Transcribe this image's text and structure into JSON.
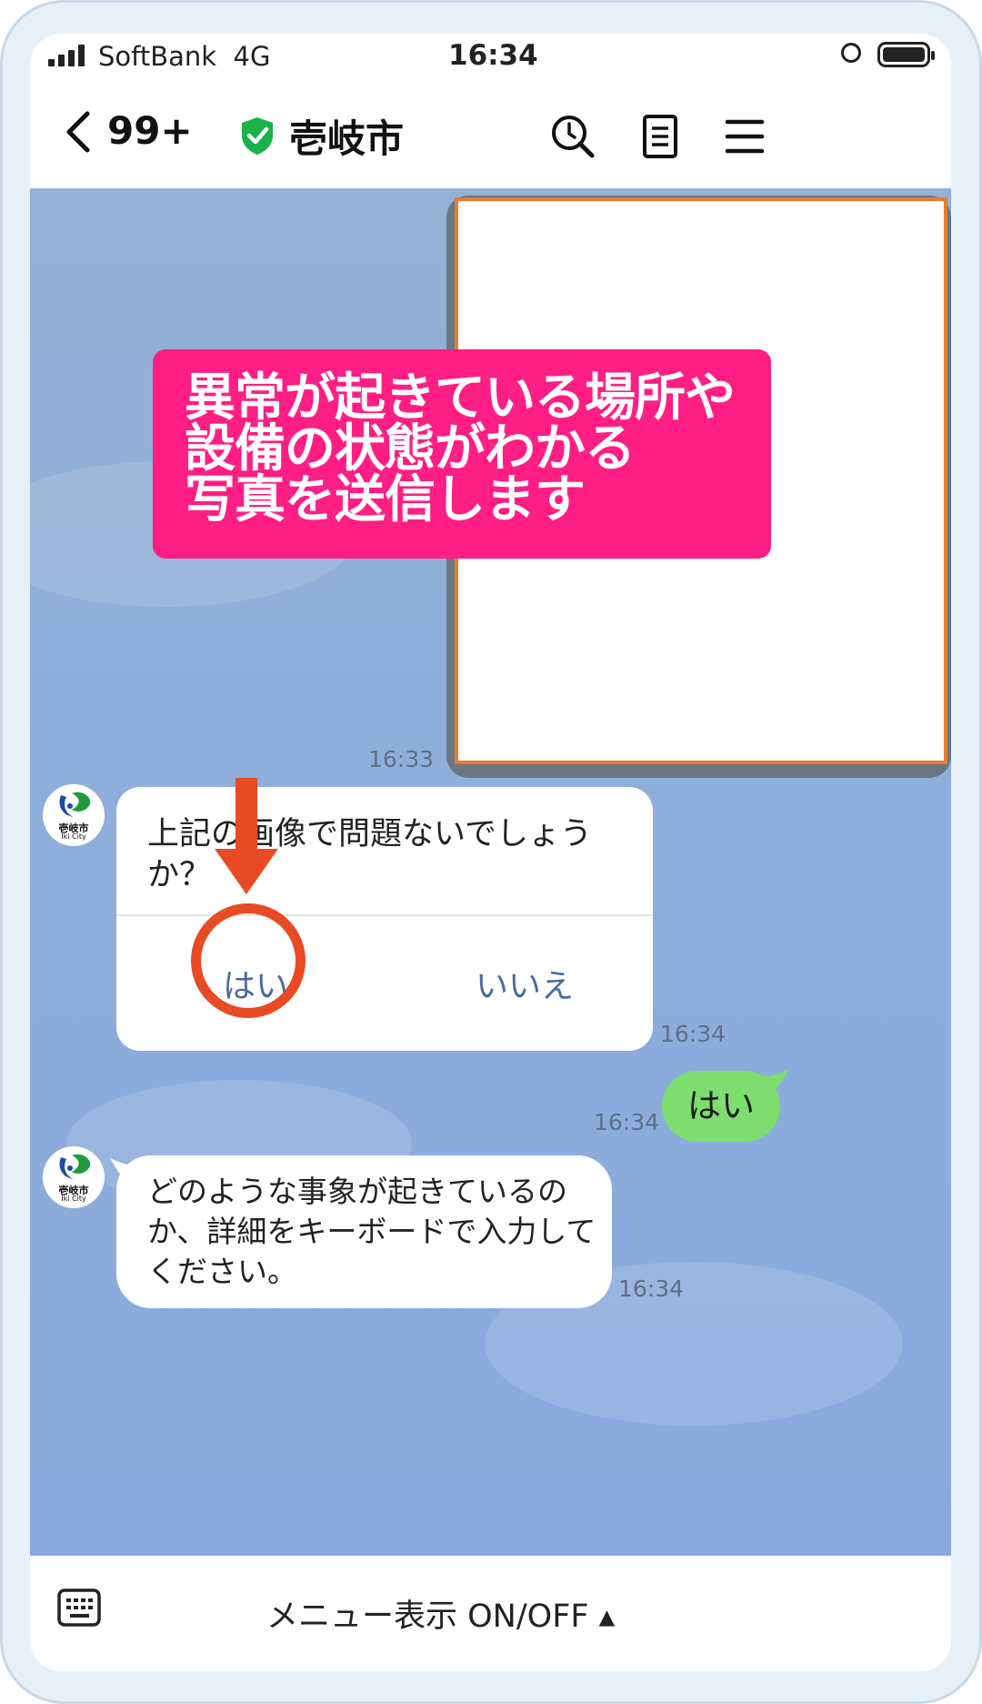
{
  "status_bar": {
    "carrier": "SoftBank",
    "network": "4G",
    "time": "16:34"
  },
  "header": {
    "back_count": "99+",
    "title": "壱岐市"
  },
  "callout": {
    "lines": [
      "異常が起きている場所や",
      "設備の状態がわかる",
      "写真を送信します"
    ]
  },
  "messages": {
    "photo_time": "16:33",
    "card": {
      "question": "上記の画像で問題ないでしょうか？",
      "yes_label": "はい",
      "no_label": "いいえ",
      "time": "16:34"
    },
    "user_reply": {
      "text": "はい",
      "time": "16:34"
    },
    "bot_reply": {
      "text": "どのような事象が起きているのか、詳細をキーボードで入力してください。",
      "time": "16:34"
    }
  },
  "avatar": {
    "label_jp": "壱岐市",
    "label_en": "Iki City"
  },
  "bottom_bar": {
    "menu_toggle": "メニュー表示 ON/OFF ▴"
  },
  "colors": {
    "accent_pink": "#ff1e84",
    "annotation_orange": "#e84a24",
    "line_green": "#7ddd6f",
    "chat_bg": "#8eaedb"
  },
  "icons": [
    "signal-icon",
    "lock-rotation-icon",
    "battery-icon",
    "back-icon",
    "verified-shield-icon",
    "search-icon",
    "notes-icon",
    "menu-icon",
    "keyboard-icon"
  ]
}
